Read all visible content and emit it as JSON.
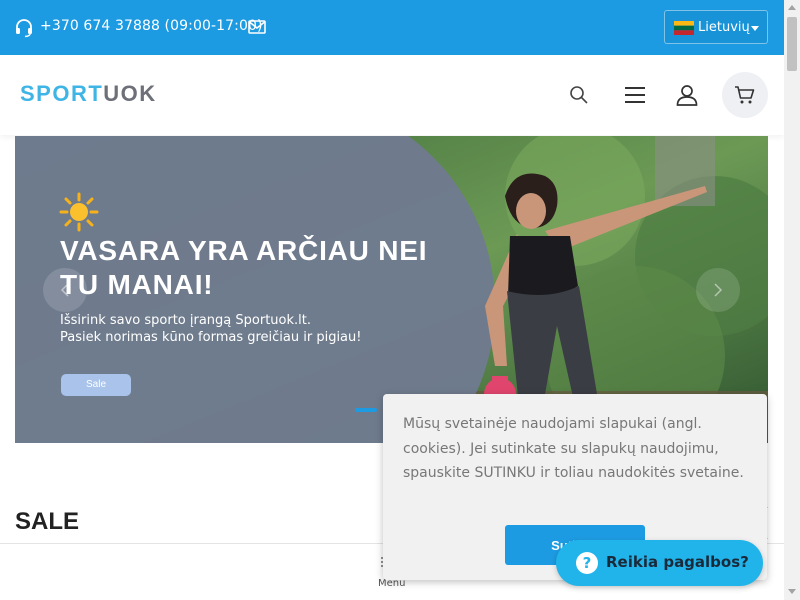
{
  "topbar": {
    "phone": "+370 674 37888 (09:00-17:00)",
    "icons": {
      "phone": "headset-icon",
      "mail": "envelope-icon"
    },
    "language": {
      "label": "Lietuvių",
      "flag": "lithuania-flag-icon"
    },
    "color": "#1d9be2"
  },
  "header": {
    "logo_part1": "SPORT",
    "logo_part2": "UOK",
    "icons": [
      "search-icon",
      "hamburger-menu-icon",
      "user-icon",
      "cart-icon"
    ]
  },
  "hero": {
    "headline": "VASARA YRA ARČIAU NEI TU MANAI!",
    "subtitle_line1": "Išsirink savo sporto įrangą Sportuok.lt.",
    "subtitle_line2": "Pasiek norimas kūno formas greičiau ir pigiau!",
    "button": "Sale"
  },
  "sale": {
    "title": "SALE"
  },
  "bottom_bar": {
    "menu_label": "Menu"
  },
  "cookie": {
    "text": "Mūsų svetainėje naudojami slapukai (angl. cookies). Jei sutinkate su slapukų naudojimu, spauskite SUTINKU ir toliau naudokitės svetaine.",
    "accept": "Sutinku"
  },
  "help": {
    "label": "Reikia pagalbos?",
    "icon": "question-icon"
  }
}
